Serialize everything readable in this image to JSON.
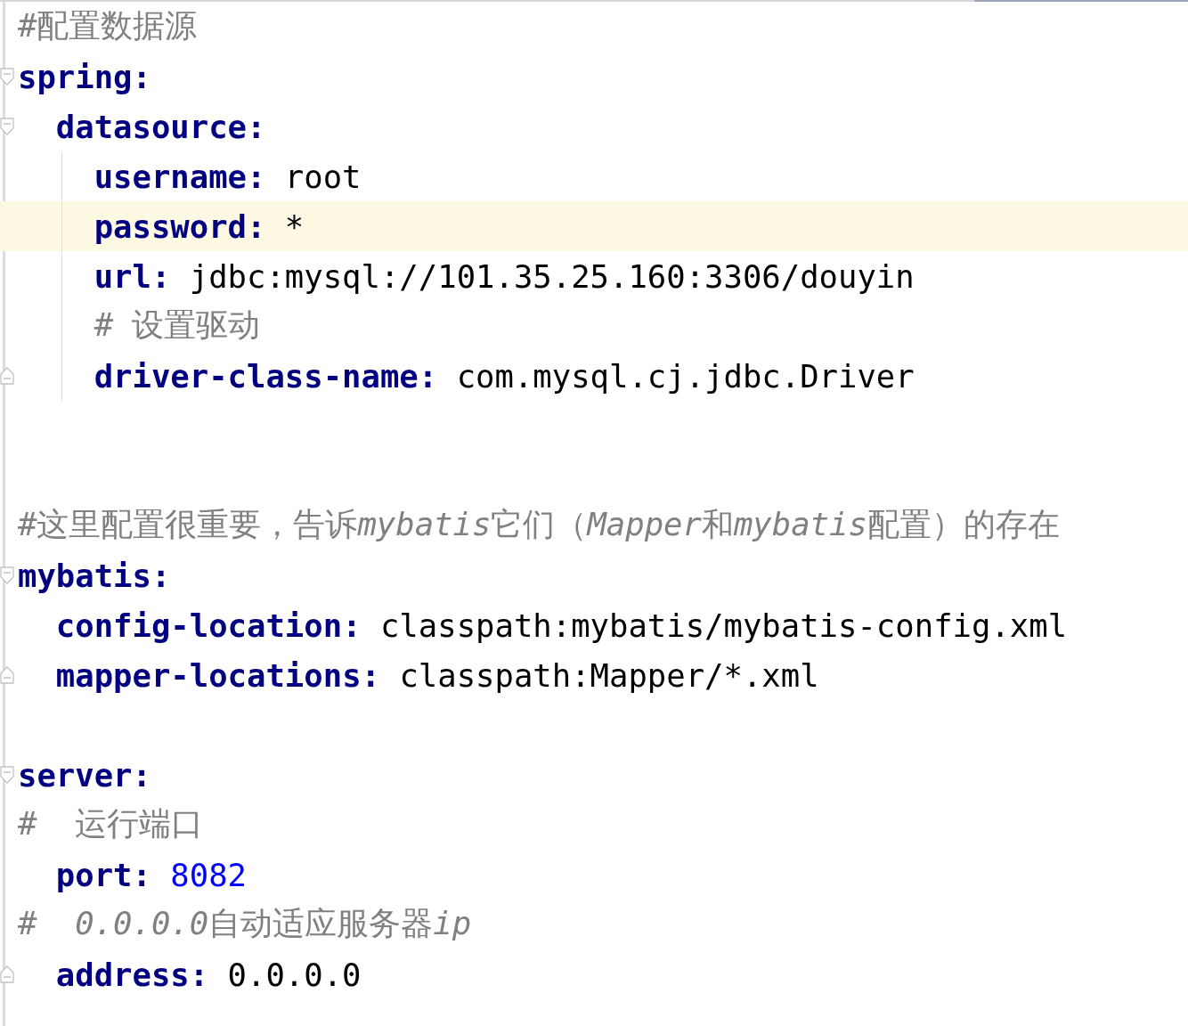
{
  "editor": {
    "lines": [
      {
        "kind": "comment",
        "parts": [
          {
            "text": "#配置数据源",
            "italic": false
          }
        ],
        "current_line": false
      },
      {
        "kind": "mapping",
        "key": "spring:",
        "current_line": false,
        "children": [
          {
            "kind": "mapping",
            "key": "datasource:",
            "current_line": false,
            "children": [
              {
                "kind": "pair",
                "key": "username:",
                "value": "root",
                "current_line": false
              },
              {
                "kind": "pair",
                "key": "password:",
                "value": "*",
                "current_line": true
              },
              {
                "kind": "pair",
                "key": "url:",
                "value": "jdbc:mysql://101.35.25.160:3306/douyin",
                "current_line": false
              },
              {
                "kind": "comment",
                "parts": [
                  {
                    "text": "# 设置驱动",
                    "italic": false
                  }
                ],
                "current_line": false
              },
              {
                "kind": "pair",
                "key": "driver-class-name:",
                "value": "com.mysql.cj.jdbc.Driver",
                "current_line": false
              }
            ]
          }
        ]
      },
      {
        "kind": "blank",
        "current_line": false
      },
      {
        "kind": "blank",
        "current_line": false
      },
      {
        "kind": "comment",
        "parts": [
          {
            "text": "#这里配置很重要，告诉",
            "italic": false
          },
          {
            "text": "mybatis",
            "italic": true
          },
          {
            "text": "它们（",
            "italic": false
          },
          {
            "text": "Mapper",
            "italic": true
          },
          {
            "text": "和",
            "italic": false
          },
          {
            "text": "mybatis",
            "italic": true
          },
          {
            "text": "配置）的存在",
            "italic": false
          }
        ],
        "current_line": false
      },
      {
        "kind": "mapping",
        "key": "mybatis:",
        "current_line": false,
        "children": [
          {
            "kind": "pair",
            "key": "config-location:",
            "value": "classpath:mybatis/mybatis-config.xml",
            "current_line": false
          },
          {
            "kind": "pair",
            "key": "mapper-locations:",
            "value": "classpath:Mapper/*.xml",
            "current_line": false
          }
        ]
      },
      {
        "kind": "blank",
        "current_line": false
      },
      {
        "kind": "mapping",
        "key": "server:",
        "current_line": false,
        "children": [
          {
            "kind": "comment-margin",
            "parts": [
              {
                "text": "#  运行端口",
                "italic": false
              }
            ],
            "current_line": false
          },
          {
            "kind": "number-pair",
            "key": "port:",
            "value": "8082",
            "current_line": false
          },
          {
            "kind": "comment-margin",
            "parts": [
              {
                "text": "#  ",
                "italic": false
              },
              {
                "text": "0.0.0.0",
                "italic": true
              },
              {
                "text": "自动适应服务器",
                "italic": false
              },
              {
                "text": "ip",
                "italic": true
              }
            ],
            "current_line": false
          },
          {
            "kind": "pair",
            "key": "address:",
            "value": "0.0.0.0",
            "current_line": false
          }
        ]
      }
    ]
  }
}
